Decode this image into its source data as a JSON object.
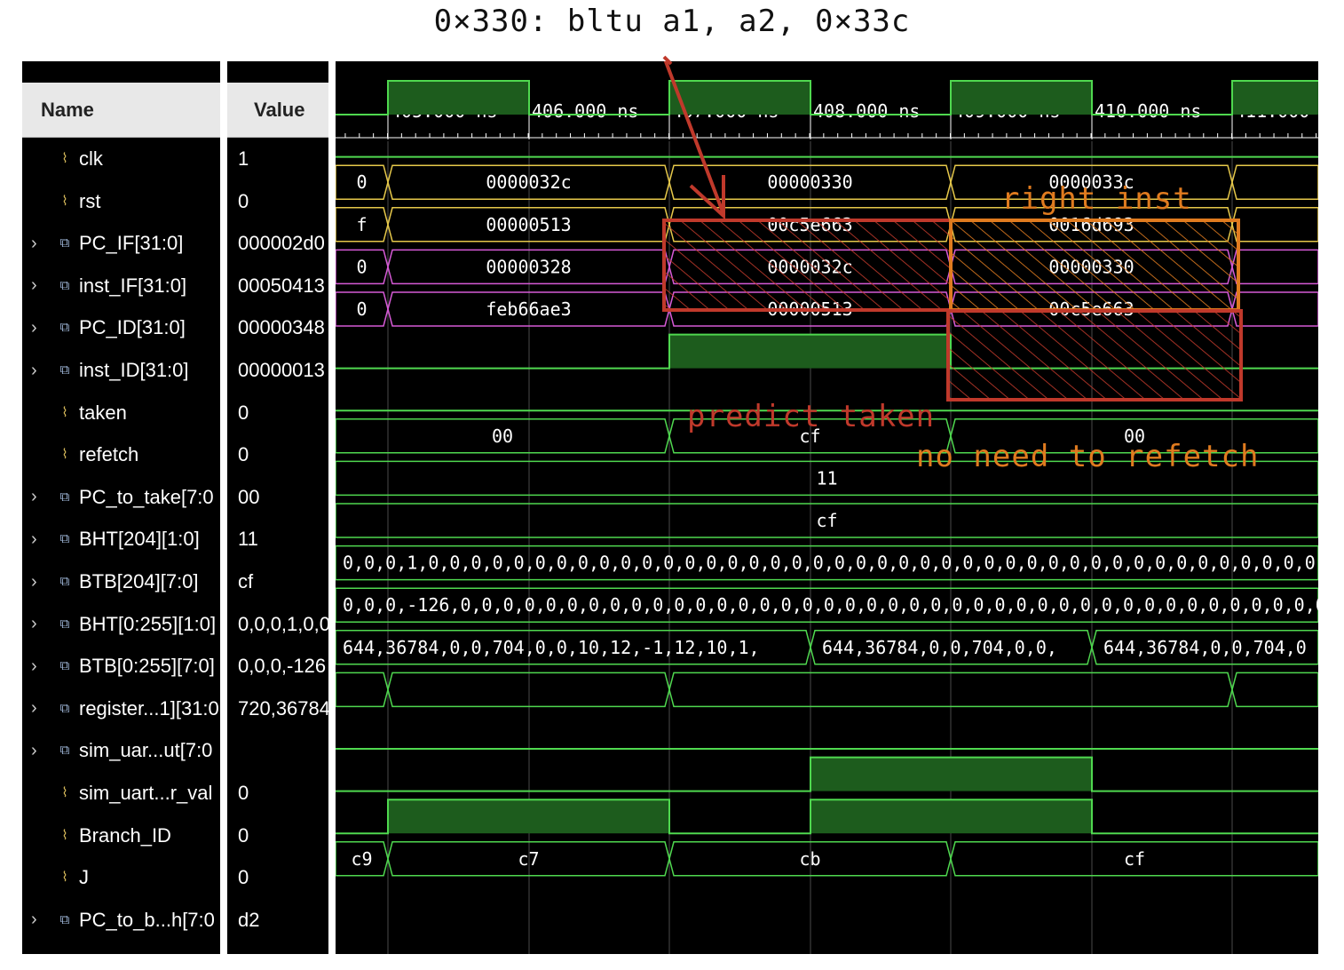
{
  "caption": "0×330: bltu a1, a2, 0×33c",
  "columns": {
    "name": "Name",
    "value": "Value"
  },
  "time_axis": {
    "labels": [
      "405.000 ns",
      "406.000 ns",
      "407.000 ns",
      "408.000 ns",
      "409.000 ns",
      "410.000 ns",
      "411.000"
    ]
  },
  "signals": [
    {
      "name": "clk",
      "value": "1",
      "expandable": false,
      "icon": "bit-signal-icon"
    },
    {
      "name": "rst",
      "value": "0",
      "expandable": false,
      "icon": "bit-signal-icon"
    },
    {
      "name": "PC_IF[31:0]",
      "value": "000002d0",
      "expandable": true,
      "icon": "bus-signal-icon"
    },
    {
      "name": "inst_IF[31:0]",
      "value": "00050413",
      "expandable": true,
      "icon": "bus-signal-icon"
    },
    {
      "name": "PC_ID[31:0]",
      "value": "00000348",
      "expandable": true,
      "icon": "bus-signal-icon"
    },
    {
      "name": "inst_ID[31:0]",
      "value": "00000013",
      "expandable": true,
      "icon": "bus-signal-icon"
    },
    {
      "name": "taken",
      "value": "0",
      "expandable": false,
      "icon": "bit-signal-icon"
    },
    {
      "name": "refetch",
      "value": "0",
      "expandable": false,
      "icon": "bit-signal-icon"
    },
    {
      "name": "PC_to_take[7:0",
      "value": "00",
      "expandable": true,
      "icon": "bus-signal-icon"
    },
    {
      "name": "BHT[204][1:0]",
      "value": "11",
      "expandable": true,
      "icon": "bus-signal-icon"
    },
    {
      "name": "BTB[204][7:0]",
      "value": "cf",
      "expandable": true,
      "icon": "bus-signal-icon"
    },
    {
      "name": "BHT[0:255][1:0]",
      "value": "0,0,0,1,0,0",
      "expandable": true,
      "icon": "bus-signal-icon"
    },
    {
      "name": "BTB[0:255][7:0]",
      "value": "0,0,0,-126",
      "expandable": true,
      "icon": "bus-signal-icon"
    },
    {
      "name": "register...1][31:0",
      "value": "720,36784",
      "expandable": true,
      "icon": "bus-signal-icon"
    },
    {
      "name": "sim_uar...ut[7:0",
      "value": "",
      "expandable": true,
      "icon": "bus-signal-icon"
    },
    {
      "name": "sim_uart...r_val",
      "value": "0",
      "expandable": false,
      "icon": "bit-signal-icon"
    },
    {
      "name": "Branch_ID",
      "value": "0",
      "expandable": false,
      "icon": "bit-signal-icon"
    },
    {
      "name": "J",
      "value": "0",
      "expandable": false,
      "icon": "bit-signal-icon"
    },
    {
      "name": "PC_to_b...h[7:0",
      "value": "d2",
      "expandable": true,
      "icon": "bus-signal-icon"
    }
  ],
  "waves": [
    {
      "type": "bit",
      "levels": [
        0,
        1,
        0,
        1,
        0,
        1,
        0,
        1
      ]
    },
    {
      "type": "bit",
      "levels": [
        0,
        0,
        0,
        0,
        0,
        0,
        0,
        0
      ]
    },
    {
      "type": "bus",
      "color": "#e6c84a",
      "segments": [
        "0",
        "0000032c",
        "00000330",
        "0000033c",
        ""
      ]
    },
    {
      "type": "bus",
      "color": "#e6c84a",
      "segments": [
        "f",
        "00000513",
        "00c5e663",
        "0016d693",
        ""
      ]
    },
    {
      "type": "bus",
      "color": "#d65ad6",
      "segments": [
        "0",
        "00000328",
        "0000032c",
        "00000330",
        ""
      ]
    },
    {
      "type": "bus",
      "color": "#d65ad6",
      "segments": [
        "0",
        "feb66ae3",
        "00000513",
        "00c5e663",
        ""
      ]
    },
    {
      "type": "bit",
      "levels": [
        0,
        0,
        0,
        1,
        1,
        0,
        0,
        0
      ]
    },
    {
      "type": "bit",
      "levels": [
        0,
        0,
        0,
        0,
        0,
        0,
        0,
        0
      ]
    },
    {
      "type": "bus",
      "color": "#4fd84f",
      "segments": [
        "00",
        "cf",
        "00"
      ]
    },
    {
      "type": "bus",
      "color": "#4fd84f",
      "segments": [
        "11"
      ]
    },
    {
      "type": "bus",
      "color": "#4fd84f",
      "segments": [
        "cf"
      ]
    },
    {
      "type": "bus",
      "color": "#4fd84f",
      "segments": [
        "0,0,0,1,0,0,0,0,0,0,0,0,0,0,0,0,0,0,0,0,0,0,0,0,0,0,0,0,0,0,0,0,0,0,0,0,0,0,0,0,0,0,0,0,0,0,0,0,"
      ]
    },
    {
      "type": "bus",
      "color": "#4fd84f",
      "segments": [
        "0,0,0,-126,0,0,0,0,0,0,0,0,0,0,0,0,0,0,0,0,0,0,0,0,0,0,0,0,0,0,0,0,0,0,0,0,0,0,0,0,0,0,0,0,0,0,0,0,0"
      ]
    },
    {
      "type": "bus",
      "color": "#4fd84f",
      "segments": [
        "644,36784,0,0,704,0,0,10,12,-1,12,10,1,",
        "644,36784,0,0,704,0,0,",
        "644,36784,0,0,704,0"
      ]
    },
    {
      "type": "bus",
      "color": "#4fd84f",
      "segments": [
        "",
        "",
        "",
        ""
      ]
    },
    {
      "type": "bit",
      "levels": [
        0,
        0,
        0,
        0,
        0,
        0,
        0,
        0
      ]
    },
    {
      "type": "bit",
      "levels": [
        0,
        0,
        0,
        0,
        1,
        1,
        0,
        0
      ]
    },
    {
      "type": "bit",
      "levels": [
        0,
        1,
        1,
        0,
        1,
        1,
        0,
        0
      ]
    },
    {
      "type": "bus",
      "color": "#4fd84f",
      "segments": [
        "c9",
        "c7",
        "cb",
        "cf"
      ]
    }
  ],
  "annotations": {
    "right_inst": "right inst",
    "predict_taken": "predict taken",
    "no_refetch": "no need to refetch",
    "colors": {
      "red": "#c0392b",
      "orange": "#e07b1f",
      "wave_green": "#4fd84f",
      "fill_green": "#1d5c1d"
    }
  }
}
